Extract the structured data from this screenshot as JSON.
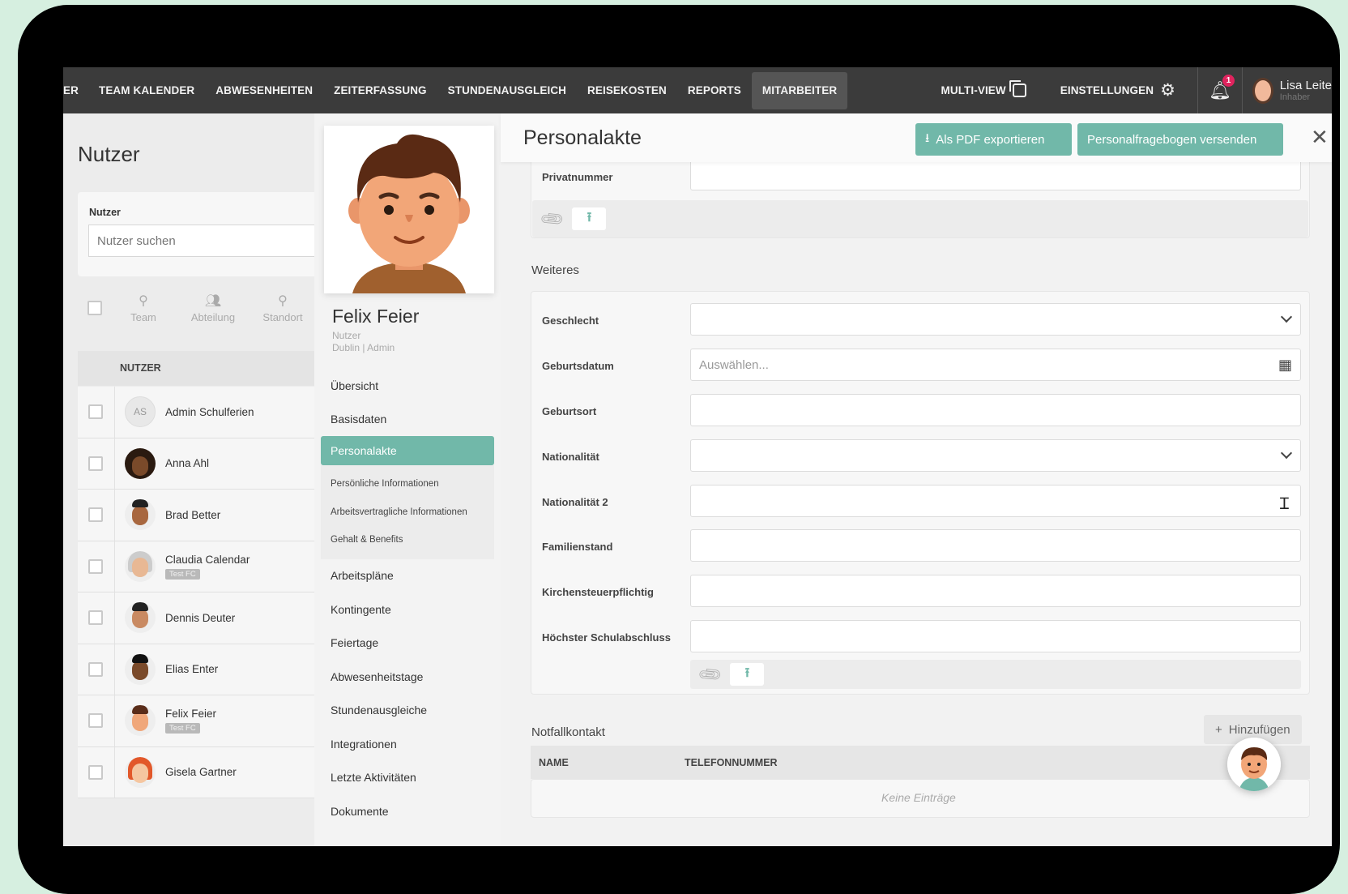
{
  "nav": {
    "items": [
      "ER",
      "TEAM KALENDER",
      "ABWESENHEITEN",
      "ZEITERFASSUNG",
      "STUNDENAUSGLEICH",
      "REISEKOSTEN",
      "REPORTS",
      "MITARBEITER"
    ],
    "active": "MITARBEITER",
    "multiview": "MULTI-VIEW",
    "settings": "EINSTELLUNGEN",
    "notif_count": "1",
    "user_name": "Lisa Leite",
    "user_role": "Inhaber",
    "icons": [
      "multiview-icon",
      "gear-icon",
      "bell-icon"
    ]
  },
  "left": {
    "title": "Nutzer",
    "search_label": "Nutzer",
    "search_placeholder": "Nutzer suchen",
    "filters": [
      "Team",
      "Abteilung",
      "Standort"
    ],
    "column": "NUTZER",
    "users": [
      {
        "name": "Admin Schulferien",
        "initials": "AS",
        "tag": ""
      },
      {
        "name": "Anna Ahl",
        "initials": "",
        "tag": ""
      },
      {
        "name": "Brad Better",
        "initials": "",
        "tag": ""
      },
      {
        "name": "Claudia Calendar",
        "initials": "",
        "tag": "Test FC"
      },
      {
        "name": "Dennis Deuter",
        "initials": "",
        "tag": ""
      },
      {
        "name": "Elias Enter",
        "initials": "",
        "tag": ""
      },
      {
        "name": "Felix Feier",
        "initials": "",
        "tag": "Test FC"
      },
      {
        "name": "Gisela Gartner",
        "initials": "",
        "tag": ""
      }
    ]
  },
  "profile": {
    "name": "Felix Feier",
    "role": "Nutzer",
    "location": "Dublin | Admin",
    "menu": [
      "Übersicht",
      "Basisdaten",
      "Personalakte"
    ],
    "submenu": [
      "Persönliche Informationen",
      "Arbeitsvertragliche Informationen",
      "Gehalt & Benefits"
    ],
    "menu2": [
      "Arbeitspläne",
      "Kontingente",
      "Feiertage",
      "Abwesenheitstage",
      "Stundenausgleiche",
      "Integrationen",
      "Letzte Aktivitäten",
      "Dokumente"
    ]
  },
  "panel": {
    "title": "Personalakte",
    "export_btn": "Als PDF exportieren",
    "send_btn": "Personalfragebogen versenden",
    "privatnummer_label": "Privatnummer",
    "weiteres_title": "Weiteres",
    "fields": {
      "geschlecht": "Geschlecht",
      "geburtsdatum": "Geburtsdatum",
      "geburtsdatum_placeholder": "Auswählen...",
      "geburtsort": "Geburtsort",
      "nationalitaet": "Nationalität",
      "nationalitaet2": "Nationalität 2",
      "familienstand": "Familienstand",
      "kirchensteuer": "Kirchensteuerpflichtig",
      "schulabschluss": "Höchster Schulabschluss"
    },
    "notfall_title": "Notfallkontakt",
    "add_btn": "Hinzufügen",
    "col_name": "NAME",
    "col_phone": "TELEFONNUMMER",
    "empty": "Keine Einträge"
  }
}
